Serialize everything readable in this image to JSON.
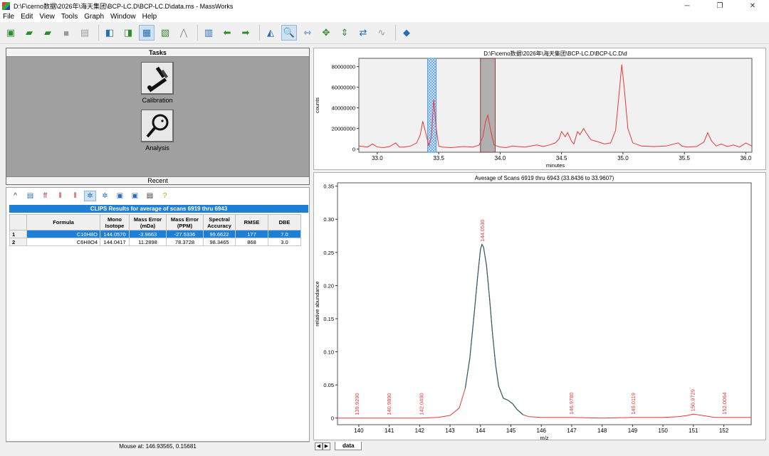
{
  "window": {
    "title": "D:\\F\\cerno数据\\2026年\\海天集团\\BCP-LC.D\\BCP-LC.D\\data.ms - MassWorks",
    "controls": [
      "─",
      "❐",
      "✕"
    ]
  },
  "menu": [
    "File",
    "Edit",
    "View",
    "Tools",
    "Graph",
    "Window",
    "Help"
  ],
  "tasks": {
    "header": "Tasks",
    "calibration_label": "Calibration",
    "analysis_label": "Analysis",
    "recent_label": "Recent"
  },
  "results": {
    "title": "CLIPS Results for average of scans 6919 thru 6943",
    "columns": [
      "",
      "Formula",
      "Mono Isotope",
      "Mass Error (mDa)",
      "Mass Error (PPM)",
      "Spectral Accuracy",
      "RMSE",
      "DBE"
    ],
    "rows": [
      [
        "1",
        "C10H8O",
        "144.0570",
        "-3.9663",
        "-27.5336",
        "99.6622",
        "177",
        "7.0"
      ],
      [
        "2",
        "C6H8O4",
        "144.0417",
        "11.2898",
        "78.3728",
        "98.3465",
        "868",
        "3.0"
      ]
    ]
  },
  "status": {
    "mouse": "Mouse at: 146.93565, 0.15681"
  },
  "tab": {
    "label": "data"
  },
  "colors": {
    "trace": "#e8383a",
    "peak": "#2f5f64",
    "selection": "#1e7fd6"
  },
  "chart_data": [
    {
      "type": "line",
      "title": "D:\\F\\cerno数据\\2026年\\海天集团\\BCP-LC.D\\BCP-LC.D\\d",
      "xlabel": "minutes",
      "ylabel": "counts",
      "xlim": [
        32.85,
        36.05
      ],
      "ylim": [
        -3000000,
        88000000
      ],
      "x_ticks": [
        33.0,
        33.5,
        34.0,
        34.5,
        35.0,
        35.5,
        36.0
      ],
      "y_ticks": [
        0,
        20000000,
        40000000,
        60000000,
        80000000
      ],
      "y_tick_labels": [
        "0",
        "20000000",
        "40000000",
        "60000000",
        "80000000"
      ],
      "x_tick_labels": [
        "33.0",
        "33.5",
        "34.0",
        "34.5",
        "35.0",
        "35.5",
        "36.0"
      ],
      "highlight_regions": [
        {
          "x": [
            33.41,
            33.48
          ],
          "style": "blue-hatch"
        },
        {
          "x": [
            33.84,
            33.96
          ],
          "style": "gray"
        }
      ],
      "series": [
        {
          "x": [
            32.85,
            32.92,
            32.96,
            33.0,
            33.05,
            33.1,
            33.15,
            33.18,
            33.22,
            33.27,
            33.32,
            33.35,
            33.37,
            33.39,
            33.42,
            33.44,
            33.46,
            33.48,
            33.5,
            33.53,
            33.6,
            33.7,
            33.78,
            33.83,
            33.86,
            33.88,
            33.9,
            33.92,
            33.95,
            34.0,
            34.05,
            34.1,
            34.2,
            34.3,
            34.35,
            34.4,
            34.45,
            34.48,
            34.5,
            34.53,
            34.55,
            34.58,
            34.6,
            34.63,
            34.65,
            34.68,
            34.7,
            34.74,
            34.8,
            34.85,
            34.9,
            34.94,
            34.97,
            34.99,
            35.01,
            35.04,
            35.08,
            35.15,
            35.25,
            35.35,
            35.45,
            35.48,
            35.52,
            35.6,
            35.66,
            35.69,
            35.72,
            35.76,
            35.8,
            35.85,
            35.9,
            35.95,
            36.0,
            36.05
          ],
          "values": [
            3000000,
            2000000,
            5000000,
            2000000,
            1500000,
            2500000,
            6000000,
            2000000,
            2000000,
            3000000,
            6000000,
            14000000,
            27000000,
            18000000,
            3000000,
            12000000,
            48000000,
            20000000,
            3000000,
            2000000,
            1500000,
            2500000,
            2000000,
            4000000,
            12000000,
            26000000,
            33000000,
            20000000,
            4000000,
            2000000,
            1500000,
            3000000,
            2000000,
            4000000,
            2500000,
            4000000,
            6000000,
            10000000,
            17000000,
            12000000,
            16000000,
            8000000,
            5000000,
            17000000,
            14000000,
            20000000,
            16000000,
            9000000,
            7000000,
            5000000,
            6000000,
            18000000,
            55000000,
            82000000,
            60000000,
            20000000,
            6000000,
            3000000,
            2500000,
            3000000,
            6000000,
            3000000,
            2000000,
            2500000,
            7000000,
            16000000,
            8000000,
            3000000,
            5000000,
            2500000,
            4000000,
            2000000,
            6000000,
            3000000
          ]
        }
      ]
    },
    {
      "type": "line",
      "title": "Average of Scans 6919 thru 6943 (33.8436 to 33.9607)",
      "xlabel": "m/z",
      "ylabel": "relative abundance",
      "xlim": [
        139.3,
        152.9
      ],
      "ylim": [
        -0.01,
        0.355
      ],
      "x_ticks": [
        140,
        141,
        142,
        143,
        144,
        145,
        146,
        147,
        148,
        149,
        150,
        151,
        152
      ],
      "y_ticks": [
        0,
        0.05,
        0.1,
        0.15,
        0.2,
        0.25,
        0.3,
        0.35
      ],
      "x_tick_labels": [
        "140",
        "141",
        "142",
        "143",
        "144",
        "145",
        "146",
        "147",
        "148",
        "149",
        "150",
        "151",
        "152"
      ],
      "y_tick_labels": [
        "0",
        "0.05",
        "0.10",
        "0.15",
        "0.20",
        "0.25",
        "0.30",
        "0.35"
      ],
      "series": [
        {
          "x": [
            139.3,
            140,
            141,
            142,
            142.6,
            143.0,
            143.3,
            143.5,
            143.65,
            143.8,
            143.9,
            144.0,
            144.05,
            144.1,
            144.2,
            144.3,
            144.4,
            144.5,
            144.6,
            144.75,
            144.9,
            145.05,
            145.2,
            145.4,
            145.6,
            146,
            147,
            148,
            149,
            150,
            150.5,
            150.8,
            151.0,
            151.3,
            151.7,
            152.9
          ],
          "values": [
            0.0,
            0.0,
            0.0,
            0.0,
            0.001,
            0.004,
            0.015,
            0.045,
            0.09,
            0.16,
            0.21,
            0.255,
            0.262,
            0.258,
            0.23,
            0.18,
            0.125,
            0.08,
            0.048,
            0.03,
            0.027,
            0.022,
            0.013,
            0.005,
            0.002,
            0.001,
            0.001,
            0.0,
            0.001,
            0.001,
            0.002,
            0.004,
            0.006,
            0.004,
            0.001,
            0.001
          ]
        }
      ],
      "peak_highlight": [
        143.5,
        145.4
      ],
      "annotations": [
        {
          "x": 139.929,
          "label": "139.9290"
        },
        {
          "x": 140.989,
          "label": "140.9890"
        },
        {
          "x": 142.049,
          "label": "142.0490"
        },
        {
          "x": 144.053,
          "label": "144.0530"
        },
        {
          "x": 146.978,
          "label": "146.9780"
        },
        {
          "x": 149.0119,
          "label": "149.0119"
        },
        {
          "x": 150.9729,
          "label": "150.9729"
        },
        {
          "x": 152.0064,
          "label": "152.0064"
        }
      ]
    }
  ]
}
